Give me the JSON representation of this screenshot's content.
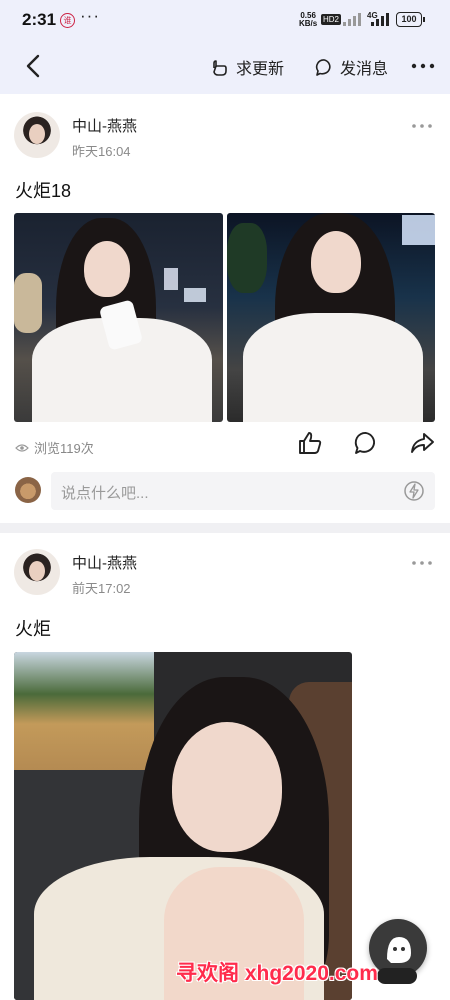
{
  "status_bar": {
    "time": "2:31",
    "net_speed_value": "0.56",
    "net_speed_unit": "KB/s",
    "hd_label": "HD2",
    "network_type": "4G",
    "battery": "100"
  },
  "nav": {
    "request_update_label": "求更新",
    "send_message_label": "发消息"
  },
  "posts": [
    {
      "username": "中山-燕燕",
      "time": "昨天16:04",
      "text": "火炬18",
      "views": "浏览119次",
      "comment_placeholder": "说点什么吧..."
    },
    {
      "username": "中山-燕燕",
      "time": "前天17:02",
      "text": "火炬"
    }
  ],
  "watermark": "寻欢阁 xhg2020.com",
  "colors": {
    "header_bg": "#eef0fb",
    "watermark": "#ff2c4c",
    "muted_text": "#8a8a8a"
  }
}
